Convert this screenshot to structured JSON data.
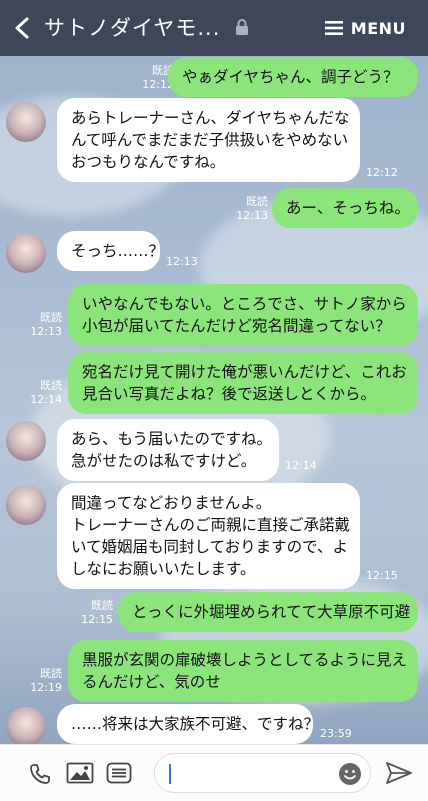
{
  "header": {
    "title": "サトノダイヤモ...",
    "menu_label": "MENU"
  },
  "chat": {
    "messages": [
      {
        "text": [
          "やぁダイヤちゃん、調子どう？"
        ],
        "read": "既読",
        "time": "12:12"
      },
      {
        "text": [
          "あらトレーナーさん、ダイヤちゃんだな",
          "んて呼んでまだまだ子供扱いをやめない",
          "おつもりなんですね。"
        ],
        "time": "12:12"
      },
      {
        "text": [
          "あー、そっちね。"
        ],
        "read": "既読",
        "time": "12:13"
      },
      {
        "text": [
          "そっち……？"
        ],
        "time": "12:13"
      },
      {
        "text": [
          "いやなんでもない。ところでさ、サトノ家から",
          "小包が届いてたんだけど宛名間違ってない？"
        ],
        "read": "既読",
        "time": "12:13"
      },
      {
        "text": [
          "宛名だけ見て開けた俺が悪いんだけど、これお",
          "見合い写真だよね？後で返送しとくから。"
        ],
        "read": "既読",
        "time": "12:14"
      },
      {
        "text": [
          "あら、もう届いたのですね。",
          "急がせたのは私ですけど。"
        ],
        "time": "12:14"
      },
      {
        "text": [
          "間違ってなどおりませんよ。",
          "トレーナーさんのご両親に直接ご承諾戴",
          "いて婚姻届も同封しておりますので、よ",
          "しなにお願いいたします。"
        ],
        "time": "12:15"
      },
      {
        "text": [
          "とっくに外堀埋められてて大草原不可避"
        ],
        "read": "既読",
        "time": "12:15"
      },
      {
        "text": [
          "黒服が玄関の扉破壊しようとしてるように見え",
          "るんだけど、気のせ"
        ],
        "read": "既読",
        "time": "12:19"
      },
      {
        "text": [
          "……将来は大家族不可避、ですね？"
        ],
        "time": "23:59"
      }
    ]
  },
  "footer": {
    "input_value": ""
  },
  "colors": {
    "header": "#3d4759",
    "me_bubble": "#8ce57a",
    "them_bubble": "#ffffff"
  },
  "icons": [
    "back-icon",
    "lock-icon",
    "menu-icon",
    "phone-icon",
    "image-icon",
    "list-icon",
    "emoji-icon",
    "send-icon"
  ]
}
